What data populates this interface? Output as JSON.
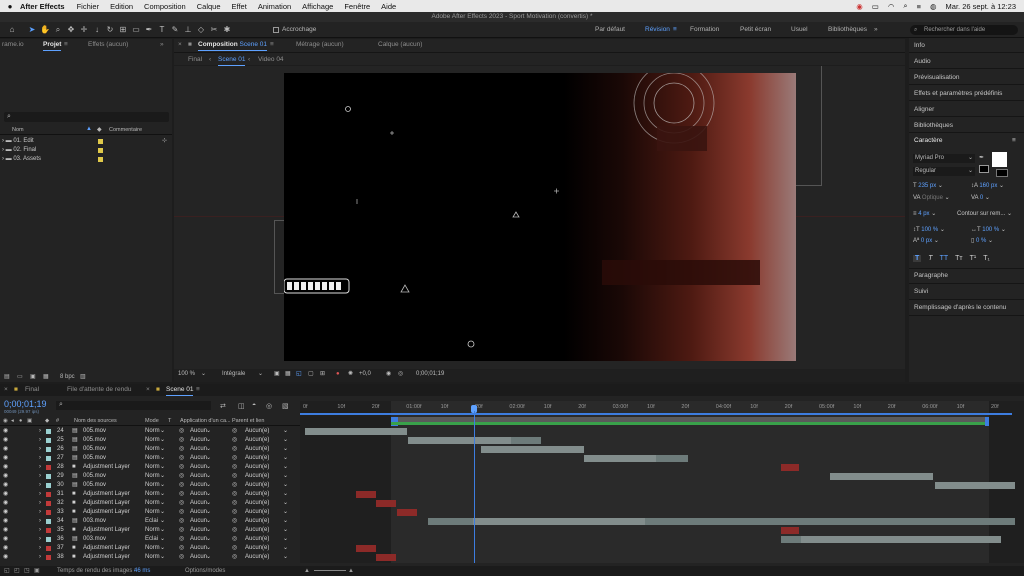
{
  "menubar": {
    "app": "After Effects",
    "items": [
      "Fichier",
      "Edition",
      "Composition",
      "Calque",
      "Effet",
      "Animation",
      "Affichage",
      "Fenêtre",
      "Aide"
    ],
    "clock": "Mar. 26 sept. à 12:23"
  },
  "window_title": "Adobe After Effects 2023 - Sport Motivation (convertis) *",
  "toolbar": {
    "snapping_label": "Accrochage",
    "workspaces": [
      "Par défaut",
      "Révision",
      "Formation",
      "Petit écran",
      "Usuel",
      "Bibliothèques"
    ],
    "active_workspace": "Révision",
    "search_placeholder": "Rechercher dans l'aide"
  },
  "project_panel": {
    "tabs": [
      "rame.io",
      "Projet",
      "Effets (aucun)"
    ],
    "col_name": "Nom",
    "col_comment": "Commentaire",
    "items": [
      {
        "name": "01. Edit"
      },
      {
        "name": "02. Final"
      },
      {
        "name": "03. Assets"
      }
    ],
    "bpc": "8 bpc"
  },
  "composition_panel": {
    "tab_label": "Composition",
    "tab_comp": "Scene 01",
    "other_tabs": [
      "Métrage (aucun)",
      "Calque (aucun)"
    ],
    "breadcrumb": [
      "Final",
      "Scene 01",
      "Video 04"
    ],
    "zoom": "100 %",
    "resolution": "Intégrale",
    "exposure": "+0,0",
    "timecode": "0;00;01;19"
  },
  "right_panel": {
    "items": [
      "Info",
      "Audio",
      "Prévisualisation",
      "Effets et paramètres prédéfinis",
      "Aligner",
      "Bibliothèques",
      "Caractère"
    ],
    "character": {
      "font": "Myriad Pro",
      "style": "Regular",
      "size": "235 px",
      "leading": "160 px",
      "kerning": "Optique",
      "tracking": "0",
      "stroke": "4 px",
      "stroke_mode": "Contour sur rem...",
      "vscale": "100 %",
      "hscale": "100 %",
      "baseline": "0 px",
      "tsume": "0 %"
    },
    "bottom_items": [
      "Paragraphe",
      "Suivi",
      "Remplissage d'après le contenu"
    ]
  },
  "timeline": {
    "tabs": [
      "Final",
      "File d'attente de rendu",
      "Scene 01"
    ],
    "active_tab": "Scene 01",
    "timecode": "0;00;01;19",
    "frames": "00049 (29.97 ips)",
    "columns": {
      "name": "Nom des sources",
      "mode": "Mode",
      "t": "T",
      "apply": "Application d'un ca...",
      "parent": "Parent et lien"
    },
    "ticks": [
      "0f",
      "10f",
      "20f",
      "01:00f",
      "10f",
      "20f",
      "02:00f",
      "10f",
      "20f",
      "03:00f",
      "10f",
      "20f",
      "04:00f",
      "10f",
      "20f",
      "05:00f",
      "10f",
      "20f",
      "06:00f",
      "10f",
      "20f"
    ],
    "layers": [
      {
        "num": "24",
        "name": "005.mov",
        "mode": "Norm",
        "color": "#9ad0d0",
        "type": "mov"
      },
      {
        "num": "25",
        "name": "005.mov",
        "mode": "Norm",
        "color": "#9ad0d0",
        "type": "mov"
      },
      {
        "num": "26",
        "name": "005.mov",
        "mode": "Norm",
        "color": "#9ad0d0",
        "type": "mov"
      },
      {
        "num": "27",
        "name": "005.mov",
        "mode": "Norm",
        "color": "#9ad0d0",
        "type": "mov"
      },
      {
        "num": "28",
        "name": "Adjustment Layer",
        "mode": "Norm",
        "color": "#c23a3a",
        "type": "adj"
      },
      {
        "num": "29",
        "name": "005.mov",
        "mode": "Norm",
        "color": "#9ad0d0",
        "type": "mov"
      },
      {
        "num": "30",
        "name": "005.mov",
        "mode": "Norm",
        "color": "#9ad0d0",
        "type": "mov"
      },
      {
        "num": "31",
        "name": "Adjustment Layer",
        "mode": "Norm",
        "color": "#c23a3a",
        "type": "adj"
      },
      {
        "num": "32",
        "name": "Adjustment Layer",
        "mode": "Norm",
        "color": "#c23a3a",
        "type": "adj"
      },
      {
        "num": "33",
        "name": "Adjustment Layer",
        "mode": "Norm",
        "color": "#c23a3a",
        "type": "adj"
      },
      {
        "num": "34",
        "name": "003.mov",
        "mode": "Eclai",
        "color": "#9ad0d0",
        "type": "mov"
      },
      {
        "num": "35",
        "name": "Adjustment Layer",
        "mode": "Norm",
        "color": "#c23a3a",
        "type": "adj"
      },
      {
        "num": "36",
        "name": "003.mov",
        "mode": "Eclai",
        "color": "#9ad0d0",
        "type": "mov"
      },
      {
        "num": "37",
        "name": "Adjustment Layer",
        "mode": "Norm",
        "color": "#c23a3a",
        "type": "adj"
      },
      {
        "num": "38",
        "name": "Adjustment Layer",
        "mode": "Norm",
        "color": "#c23a3a",
        "type": "adj"
      }
    ],
    "parent_value": "Aucun(e)",
    "apply_value": "Aucun",
    "render_time_label": "Temps de rendu des images :",
    "render_time": "46 ms",
    "options_label": "Options/modes"
  }
}
